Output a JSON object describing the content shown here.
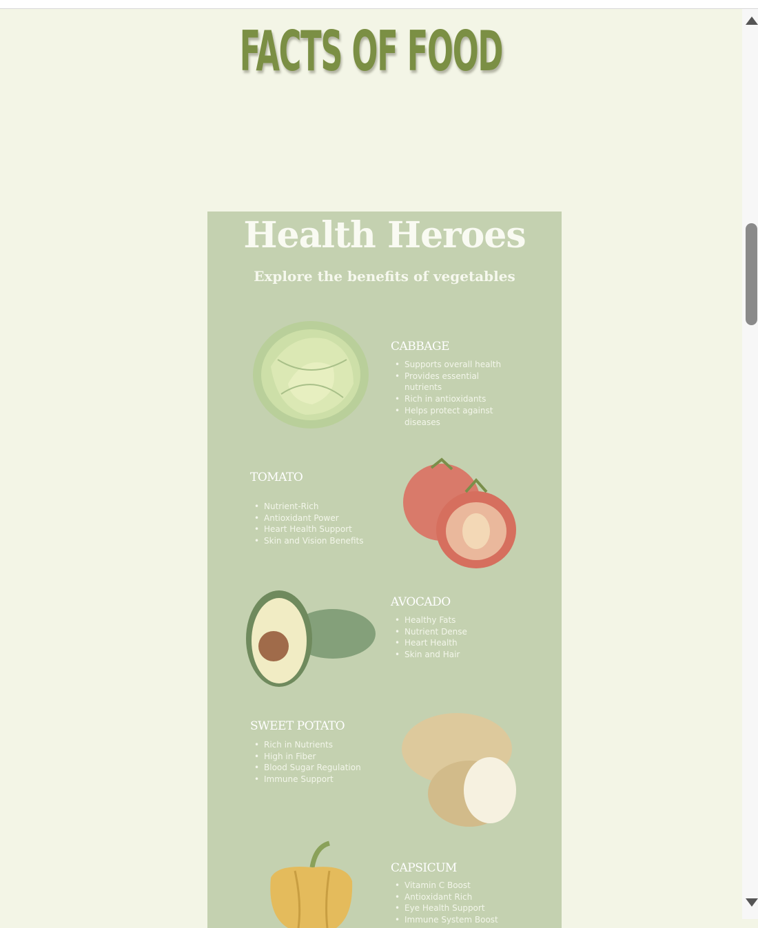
{
  "page": {
    "title": "FACTS OF FOOD"
  },
  "poster": {
    "title": "Health Heroes",
    "subtitle": "Explore the benefits of vegetables",
    "vegetables": [
      {
        "name": "CABBAGE",
        "icon": "cabbage-illustration",
        "benefits": [
          "Supports overall health",
          "Provides essential",
          "nutrients",
          "Rich in antioxidants",
          "Helps protect against",
          "diseases"
        ]
      },
      {
        "name": "TOMATO",
        "icon": "tomato-illustration",
        "benefits": [
          "Nutrient-Rich",
          "Antioxidant Power",
          "Heart Health Support",
          "Skin and Vision Benefits"
        ]
      },
      {
        "name": "AVOCADO",
        "icon": "avocado-illustration",
        "benefits": [
          "Healthy Fats",
          "Nutrient Dense",
          "Heart Health",
          "Skin and Hair"
        ]
      },
      {
        "name": "SWEET POTATO",
        "icon": "potato-illustration",
        "benefits": [
          "Rich in Nutrients",
          "High in Fiber",
          "Blood Sugar Regulation",
          "Immune Support"
        ]
      },
      {
        "name": "CAPSICUM",
        "icon": "pepper-illustration",
        "benefits": [
          "Vitamin C Boost",
          "Antioxidant Rich",
          "Eye Health Support",
          "Immune System Boost"
        ]
      }
    ]
  },
  "colors": {
    "page_bg": "#f3f5e6",
    "title_green": "#7b8f44",
    "poster_bg": "#c4d1b0"
  }
}
